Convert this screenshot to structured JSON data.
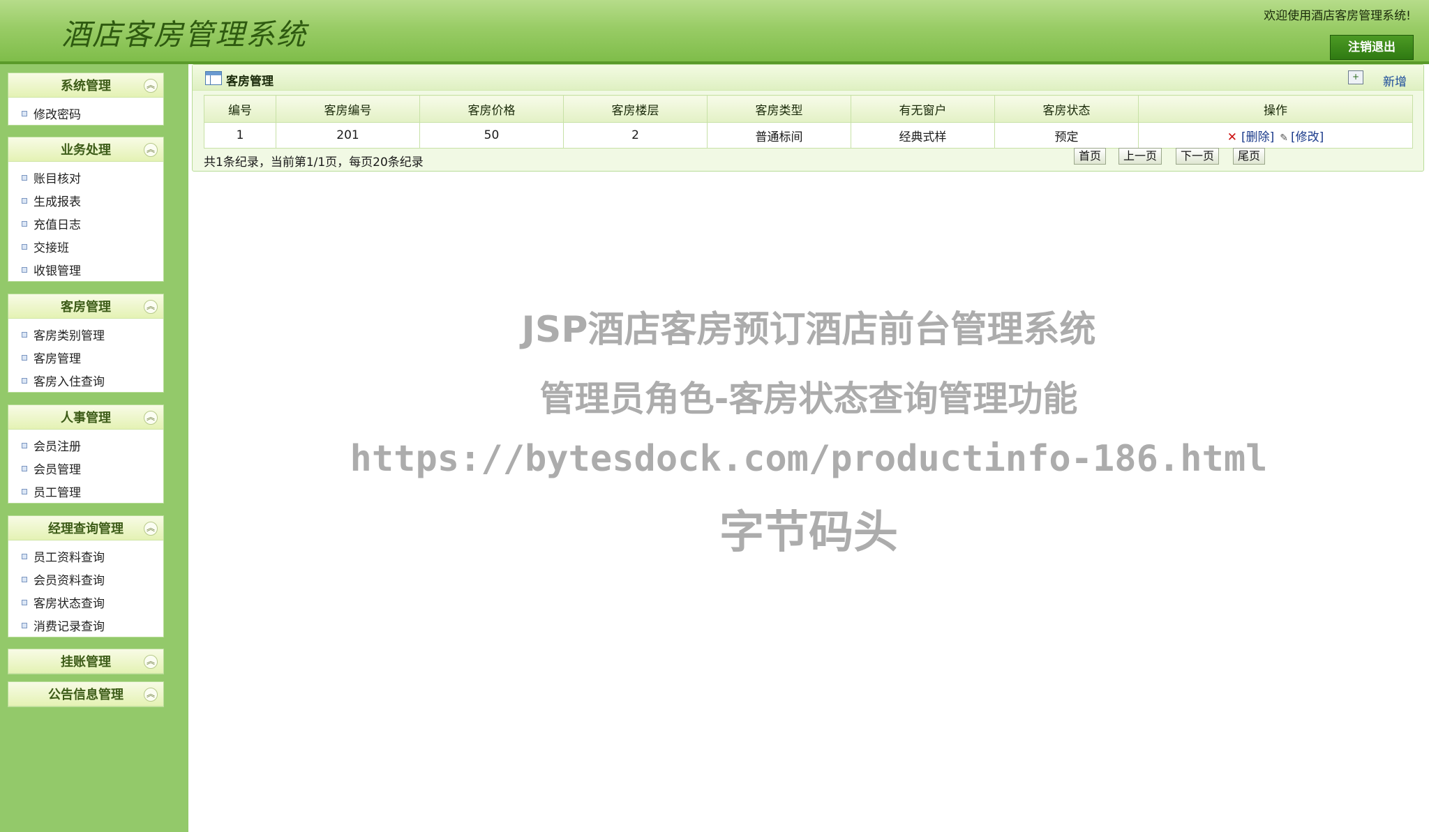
{
  "header": {
    "title": "酒店客房管理系统",
    "welcome": "欢迎使用酒店客房管理系统!",
    "logout_label": "注销退出"
  },
  "sidebar": {
    "groups": [
      {
        "title": "系统管理",
        "items": [
          "修改密码"
        ]
      },
      {
        "title": "业务处理",
        "items": [
          "账目核对",
          "生成报表",
          "充值日志",
          "交接班",
          "收银管理"
        ]
      },
      {
        "title": "客房管理",
        "items": [
          "客房类别管理",
          "客房管理",
          "客房入住查询"
        ]
      },
      {
        "title": "人事管理",
        "items": [
          "会员注册",
          "会员管理",
          "员工管理"
        ]
      },
      {
        "title": "经理查询管理",
        "items": [
          "员工资料查询",
          "会员资料查询",
          "客房状态查询",
          "消费记录查询"
        ]
      },
      {
        "title": "挂账管理",
        "items": []
      },
      {
        "title": "公告信息管理",
        "items": []
      }
    ],
    "collapse_icon": "double-chevron-up-icon"
  },
  "main": {
    "panel_title": "客房管理",
    "add_label": "新增",
    "columns": [
      "编号",
      "客房编号",
      "客房价格",
      "客房楼层",
      "客房类型",
      "有无窗户",
      "客房状态",
      "操作"
    ],
    "rows": [
      {
        "id": "1",
        "room_no": "201",
        "price": "50",
        "floor": "2",
        "type": "普通标间",
        "window": "经典式样",
        "status": "预定",
        "delete_label": "[删除]",
        "edit_label": "[修改]"
      }
    ],
    "pager": {
      "summary": "共1条纪录，当前第1/1页，每页20条纪录",
      "first": "首页",
      "prev": "上一页",
      "next": "下一页",
      "last": "尾页"
    }
  },
  "watermark": {
    "line1": "JSP酒店客房预订酒店前台管理系统",
    "line2": "管理员角色-客房状态查询管理功能",
    "line3": "https://bytesdock.com/productinfo-186.html",
    "line4": "字节码头"
  },
  "colors": {
    "header_green": "#99cc66",
    "sidebar_green": "#93c96a",
    "logout_button": "#3a8a1a",
    "delete_icon": "#cc1111",
    "link_blue": "#1a3a8a",
    "watermark": "#9e9e9e"
  }
}
